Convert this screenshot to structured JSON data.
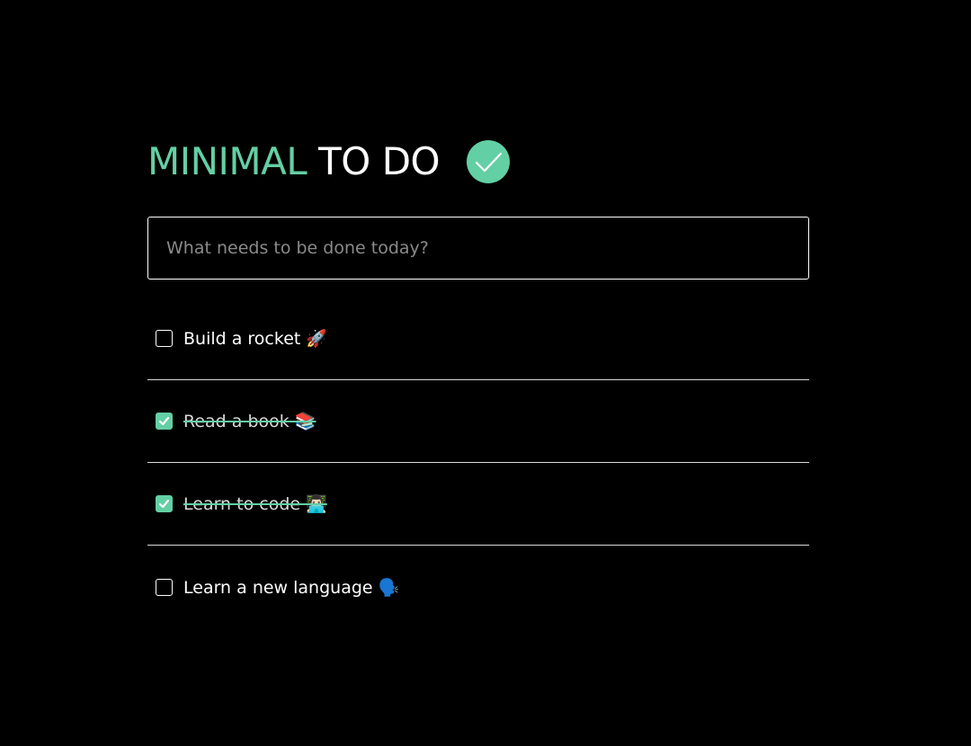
{
  "header": {
    "title_accent": "MINIMAL",
    "title_main": "TO DO",
    "logo_icon": "check-circle-icon"
  },
  "new_todo": {
    "placeholder": "What needs to be done today?",
    "value": ""
  },
  "todos": [
    {
      "text": "Build a rocket 🚀",
      "completed": false
    },
    {
      "text": "Read a book 📚",
      "completed": true
    },
    {
      "text": "Learn to code 👨🏻‍💻",
      "completed": true
    },
    {
      "text": "Learn a new language 🗣️",
      "completed": false
    }
  ],
  "colors": {
    "background": "#000000",
    "accent": "#63cfa4",
    "text": "#ffffff",
    "placeholder": "#8a8a8a",
    "divider": "#d9d9d9"
  }
}
